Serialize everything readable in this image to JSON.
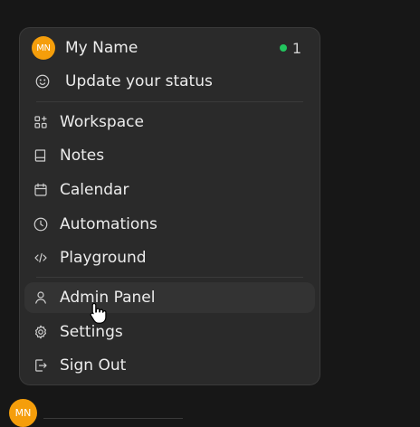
{
  "user": {
    "initials": "MN",
    "name": "My Name",
    "status_color": "#22c55e",
    "active_count": "1"
  },
  "status_item": {
    "label": "Update your status",
    "icon": "smile-icon"
  },
  "menu_items": [
    {
      "label": "Workspace",
      "icon": "grid-plus-icon"
    },
    {
      "label": "Notes",
      "icon": "notebook-icon"
    },
    {
      "label": "Calendar",
      "icon": "calendar-icon"
    },
    {
      "label": "Automations",
      "icon": "clock-icon"
    },
    {
      "label": "Playground",
      "icon": "code-icon"
    }
  ],
  "admin_items": [
    {
      "label": "Admin Panel",
      "icon": "user-icon",
      "hovered": true
    },
    {
      "label": "Settings",
      "icon": "gear-icon"
    },
    {
      "label": "Sign Out",
      "icon": "sign-out-icon"
    }
  ],
  "footer": {
    "initials": "MN"
  },
  "colors": {
    "accent": "#f59e0b",
    "background": "#171717",
    "menu": "#2a2a2a"
  }
}
